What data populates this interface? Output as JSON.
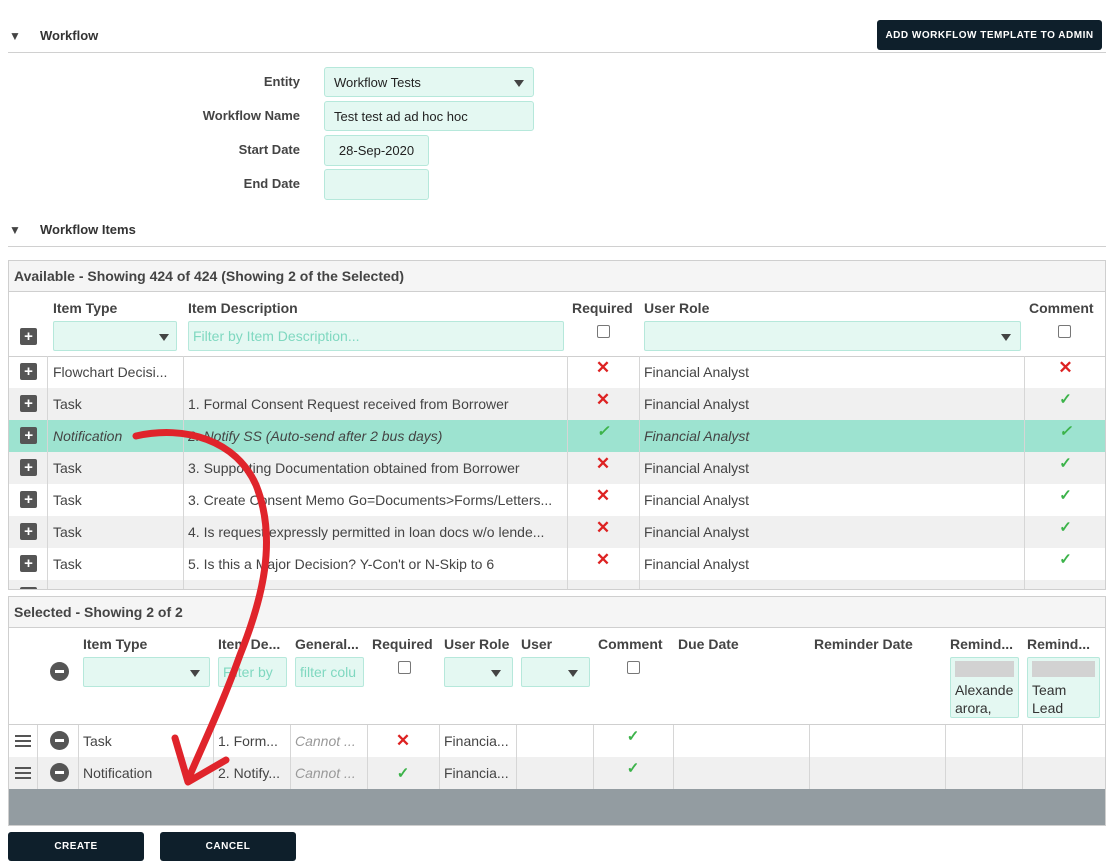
{
  "workflow_section": {
    "title": "Workflow",
    "add_button": "ADD WORKFLOW TEMPLATE TO ADMIN"
  },
  "form": {
    "entity_label": "Entity",
    "entity_value": "Workflow Tests",
    "name_label": "Workflow Name",
    "name_value": "Test test ad ad hoc hoc",
    "start_label": "Start Date",
    "start_value": "28-Sep-2020",
    "end_label": "End Date",
    "end_value": ""
  },
  "items_section": {
    "title": "Workflow Items"
  },
  "available": {
    "title": "Available - Showing 424 of 424 (Showing 2 of the Selected)",
    "headers": {
      "item_type": "Item Type",
      "item_desc": "Item Description",
      "required": "Required",
      "user_role": "User Role",
      "comment": "Comment"
    },
    "desc_placeholder": "Filter by Item Description...",
    "rows": [
      {
        "type": "Flowchart Decisi...",
        "desc": "",
        "required": "x",
        "role": "Financial Analyst",
        "comment": "x"
      },
      {
        "type": "Task",
        "desc": "1. Formal Consent Request received from Borrower",
        "required": "x",
        "role": "Financial Analyst",
        "comment": "check"
      },
      {
        "type": "Notification",
        "desc": "2. Notify SS (Auto-send after 2 bus days)",
        "required": "check",
        "role": "Financial Analyst",
        "comment": "check",
        "selected": true
      },
      {
        "type": "Task",
        "desc": "3. Supporting Documentation obtained from Borrower",
        "required": "x",
        "role": "Financial Analyst",
        "comment": "check"
      },
      {
        "type": "Task",
        "desc": "3. Create Consent Memo Go=Documents>Forms/Letters...",
        "required": "x",
        "role": "Financial Analyst",
        "comment": "check"
      },
      {
        "type": "Task",
        "desc": "4. Is request expressly permitted in loan docs w/o lende...",
        "required": "x",
        "role": "Financial Analyst",
        "comment": "check"
      },
      {
        "type": "Task",
        "desc": "5. Is this a Major Decision? Y-Con't or N-Skip to 6",
        "required": "x",
        "role": "Financial Analyst",
        "comment": "check"
      }
    ]
  },
  "selected": {
    "title": "Selected - Showing 2 of 2",
    "headers": {
      "item_type": "Item Type",
      "item_desc": "Item De...",
      "general": "General...",
      "required": "Required",
      "user_role": "User Role",
      "user": "User",
      "comment": "Comment",
      "due": "Due Date",
      "reminder": "Reminder Date",
      "remind1": "Remind...",
      "remind2": "Remind..."
    },
    "desc_placeholder": "Filter by",
    "general_placeholder": "filter colu",
    "remind1_text": "Alexander arora, anu",
    "remind2_text": "Team Lead Small Loan",
    "rows": [
      {
        "type": "Task",
        "desc": "1. Form...",
        "general": "Cannot ...",
        "required": "x",
        "role": "Financia...",
        "comment": "check"
      },
      {
        "type": "Notification",
        "desc": "2. Notify...",
        "general": "Cannot ...",
        "required": "check",
        "role": "Financia...",
        "comment": "check"
      }
    ]
  },
  "buttons": {
    "create": "CREATE",
    "cancel": "CANCEL"
  },
  "colors": {
    "dark": "#0e1f2b",
    "mint": "#e4f8f2",
    "selected_row": "#9de3d0",
    "arrow": "#e0242b"
  }
}
